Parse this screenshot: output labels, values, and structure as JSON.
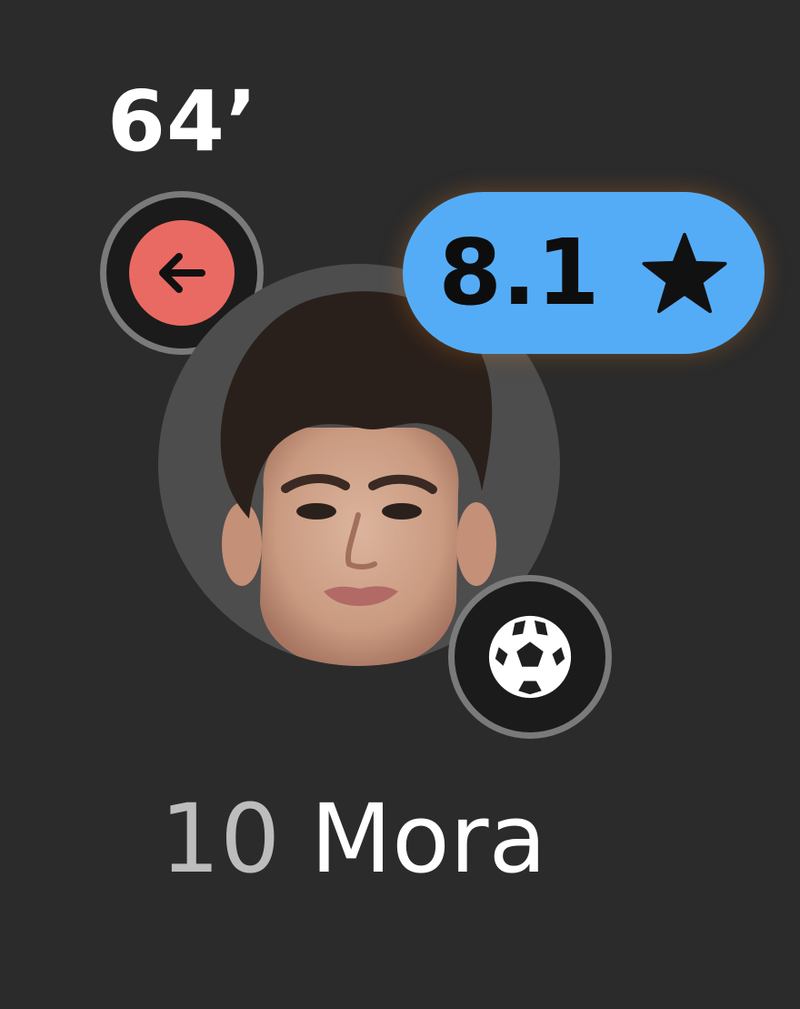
{
  "player": {
    "substitution_minute": "64’",
    "rating": "8.1",
    "shirt_number": "10",
    "name": "Mora"
  },
  "icons": {
    "substitution": "left-arrow-icon",
    "rating": "star-icon",
    "event": "football-icon"
  },
  "colors": {
    "background": "#2b2b2b",
    "substitution_badge": "#e96a63",
    "rating_pill": "#55acf6",
    "badge_ring": "#7a7a7a",
    "number_text": "#bdbdbd"
  }
}
